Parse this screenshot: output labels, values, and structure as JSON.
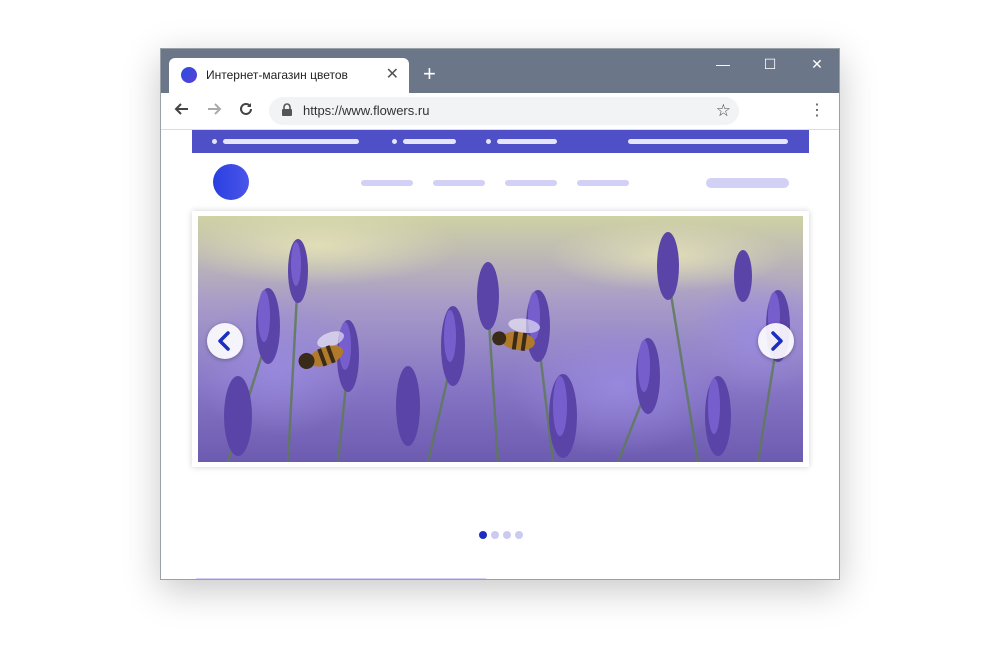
{
  "browser": {
    "tab_title": "Интернет-магазин цветов",
    "tab_close": "✕",
    "new_tab": "+",
    "url": "https://www.flowers.ru",
    "controls": {
      "minimize": "—",
      "maximize": "☐",
      "close": "✕"
    }
  },
  "icons": {
    "favicon": "globe-circle-icon",
    "back": "arrow-left-icon",
    "forward": "arrow-right-icon",
    "reload": "reload-icon",
    "lock": "lock-icon",
    "star": "star-icon",
    "menu": "kebab-menu-icon",
    "slider_prev": "chevron-left-icon",
    "slider_next": "chevron-right-icon"
  },
  "carousel": {
    "slide_count": 4,
    "active_index": 0
  },
  "colors": {
    "chrome_bar": "#6b7689",
    "site_topbar": "#4f4fc8",
    "placeholder": "#d2d0f4",
    "accent": "#1a2fc0",
    "lavender": "#8a7ad0"
  }
}
